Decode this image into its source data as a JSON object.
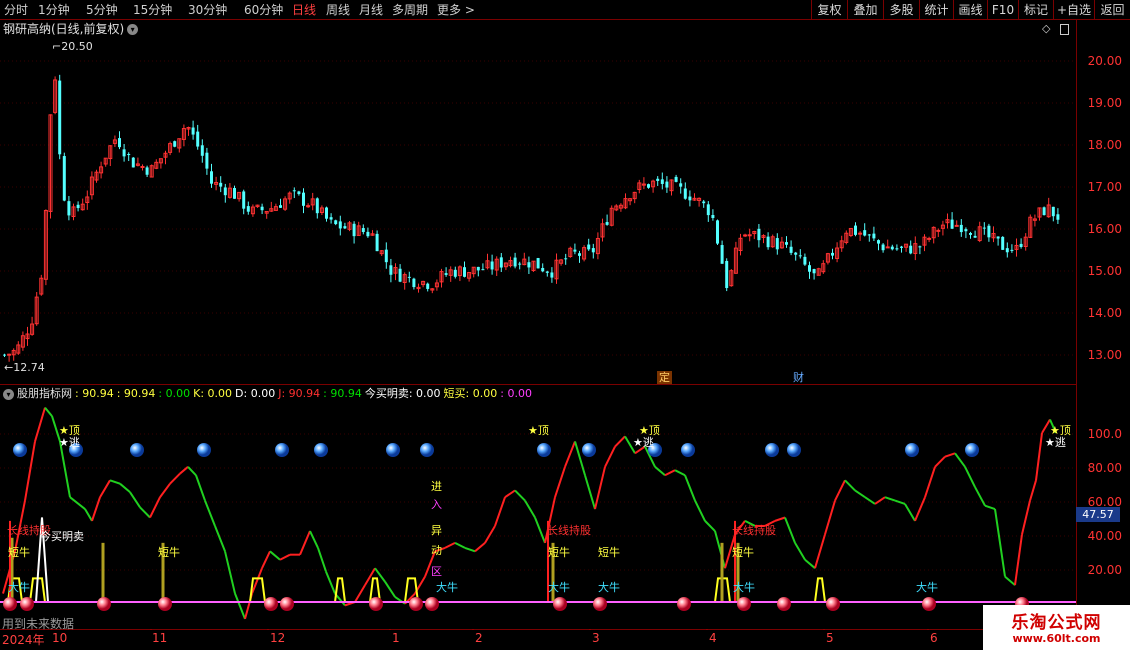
{
  "toolbar": {
    "timeframes": [
      "分时",
      "1分钟",
      "5分钟",
      "15分钟",
      "30分钟",
      "60分钟",
      "日线",
      "周线",
      "月线",
      "多周期",
      "更多 >"
    ],
    "active_timeframe": "日线",
    "right_buttons": [
      "复权",
      "叠加",
      "多股",
      "统计",
      "画线",
      "F10",
      "标记",
      "+自选",
      "返回"
    ]
  },
  "main_chart": {
    "title": "钢研高纳(日线,前复权)",
    "high_label": "20.50",
    "low_label": "12.74",
    "y_ticks": [
      "20.00",
      "19.00",
      "18.00",
      "17.00",
      "16.00",
      "15.00",
      "14.00",
      "13.00"
    ],
    "event_markers": [
      "定",
      "财"
    ]
  },
  "indicator": {
    "name": "股朋指标网",
    "values": [
      {
        "text": ": 90.94",
        "color": "#ffff40"
      },
      {
        "text": ": 90.94",
        "color": "#ffff40"
      },
      {
        "text": ": 0.00",
        "color": "#00e000"
      },
      {
        "text": "K: 0.00",
        "color": "#ffff40"
      },
      {
        "text": "D: 0.00",
        "color": "#ffffff"
      },
      {
        "text": "J: 90.94",
        "color": "#ff3030"
      },
      {
        "text": ": 90.94",
        "color": "#00e000"
      },
      {
        "text": "今买明卖: 0.00",
        "color": "#ffffff"
      },
      {
        "text": "短买: 0.00",
        "color": "#ffff40"
      },
      {
        "text": ": 0.00",
        "color": "#ff40ff"
      }
    ],
    "y_ticks": [
      "100.0",
      "80.00",
      "60.00",
      "40.00",
      "20.00"
    ],
    "current_value": "47.57",
    "labels": {
      "top": "★顶",
      "escape": "★逃",
      "long_hold": "长线持股",
      "buy_today": "今买明卖",
      "short_bull": "短牛",
      "big_bull": "大牛",
      "enter": "进",
      "in": "入",
      "abnormal1": "异",
      "abnormal2": "动",
      "abnormal3": "区"
    }
  },
  "footer": {
    "future_text": "用到未来数据",
    "dates": [
      "2024年",
      "10",
      "11",
      "12",
      "1",
      "2",
      "3",
      "4",
      "5",
      "6"
    ]
  },
  "watermark": {
    "title": "乐淘公式网",
    "url": "www.60lt.com"
  },
  "colors": {
    "up": "#ff3232",
    "down": "#54ffff",
    "grid": "#7a0000"
  }
}
